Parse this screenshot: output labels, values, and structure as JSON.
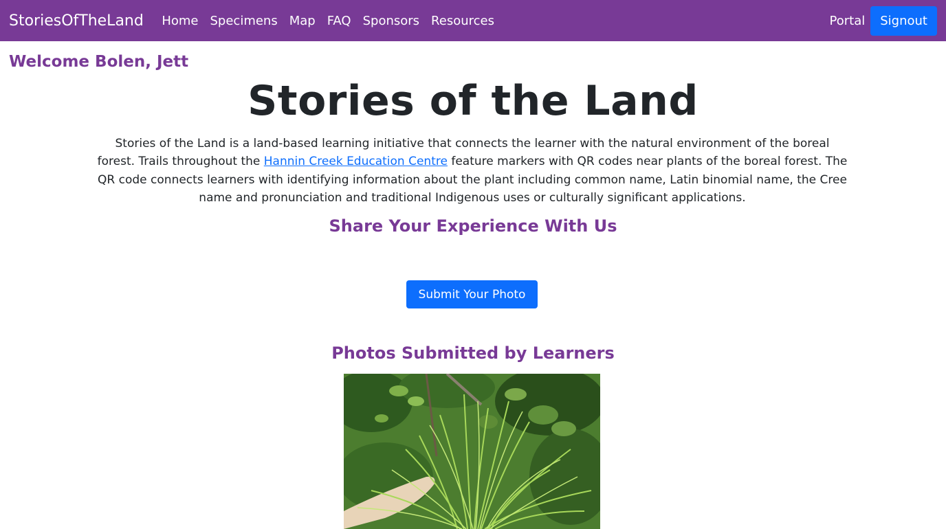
{
  "nav": {
    "brand": "StoriesOfTheLand",
    "links": [
      "Home",
      "Specimens",
      "Map",
      "FAQ",
      "Sponsors",
      "Resources"
    ],
    "portal": "Portal",
    "signout": "Signout"
  },
  "welcome": "Welcome Bolen, Jett",
  "title": "Stories of the Land",
  "intro": {
    "before_link": "Stories of the Land is a land-based learning initiative that connects the learner with the natural environment of the boreal forest. Trails throughout the ",
    "link_text": "Hannin Creek Education Centre",
    "after_link": " feature markers with QR codes near plants of the boreal forest. The QR code connects learners with identifying information about the plant including common name, Latin binomial name, the Cree name and pronunciation and traditional Indigenous uses or culturally significant applications."
  },
  "share_heading": "Share Your Experience With Us",
  "submit_button": "Submit Your Photo",
  "photos_heading": "Photos Submitted by Learners",
  "colors": {
    "brand_purple": "#783a96",
    "primary_blue": "#0d6efd",
    "text_dark": "#212529"
  }
}
